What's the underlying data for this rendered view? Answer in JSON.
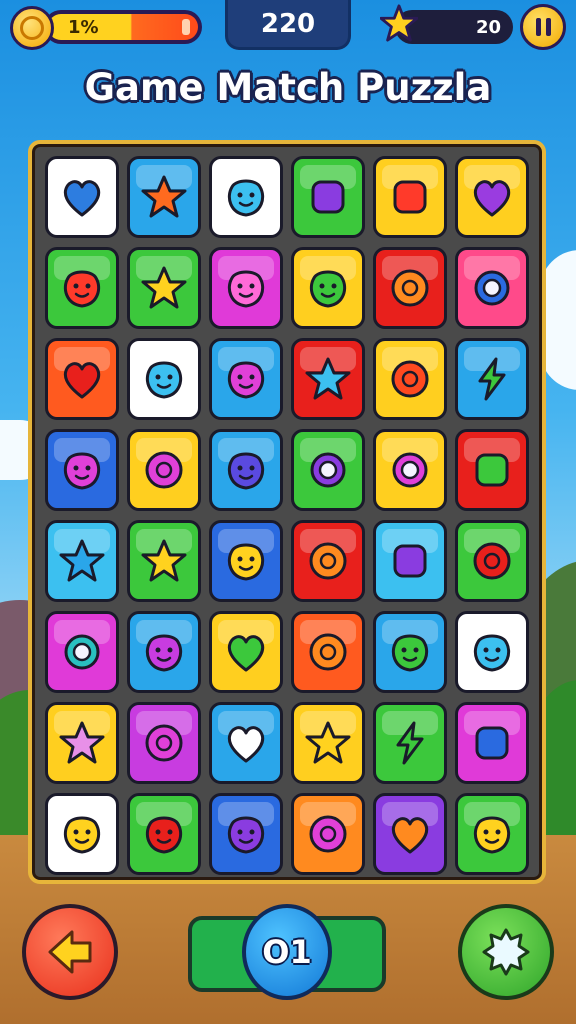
{
  "hud": {
    "coins_text": "1%",
    "score": "220",
    "stars": "20"
  },
  "title": "Game Match Puzzla",
  "board": {
    "rows": [
      [
        {
          "c": "#ffffff",
          "i": "heart",
          "g": "#2d7de0"
        },
        {
          "c": "#2aa6ea",
          "i": "star",
          "g": "#ff6a1f"
        },
        {
          "c": "#ffffff",
          "i": "face",
          "g": "#3cc0f0"
        },
        {
          "c": "#3cc83c",
          "i": "square",
          "g": "#8a3ce0"
        },
        {
          "c": "#ffcf1f",
          "i": "square",
          "g": "#ff3a2a"
        },
        {
          "c": "#ffcf1f",
          "i": "heart",
          "g": "#9a3ce0"
        }
      ],
      [
        {
          "c": "#3cc83c",
          "i": "face",
          "g": "#ff3a2a"
        },
        {
          "c": "#3cc83c",
          "i": "star",
          "g": "#ffd21f"
        },
        {
          "c": "#e03ad8",
          "i": "face",
          "g": "#ff6ad8"
        },
        {
          "c": "#ffcf1f",
          "i": "face",
          "g": "#3cc83c"
        },
        {
          "c": "#e8201c",
          "i": "circle",
          "g": "#ff8a1f"
        },
        {
          "c": "#ff4a8a",
          "i": "ring",
          "g": "#2a6ae0"
        }
      ],
      [
        {
          "c": "#ff5a1f",
          "i": "heart",
          "g": "#e8201c"
        },
        {
          "c": "#ffffff",
          "i": "face",
          "g": "#3cc0f0"
        },
        {
          "c": "#2aa6ea",
          "i": "face",
          "g": "#e040d8"
        },
        {
          "c": "#e8201c",
          "i": "star",
          "g": "#3cc0f0"
        },
        {
          "c": "#ffcf1f",
          "i": "circle",
          "g": "#ff4a1f"
        },
        {
          "c": "#2aa6ea",
          "i": "bolt",
          "g": "#3cc83c"
        }
      ],
      [
        {
          "c": "#2a6ae0",
          "i": "face",
          "g": "#e040d8"
        },
        {
          "c": "#ffcf1f",
          "i": "circle",
          "g": "#e040d8"
        },
        {
          "c": "#2aa6ea",
          "i": "face",
          "g": "#5a4ae0"
        },
        {
          "c": "#3cc83c",
          "i": "ring",
          "g": "#8a3ce0"
        },
        {
          "c": "#ffcf1f",
          "i": "ring",
          "g": "#e040d8"
        },
        {
          "c": "#e8201c",
          "i": "square",
          "g": "#3cc83c"
        }
      ],
      [
        {
          "c": "#3cc0f0",
          "i": "star",
          "g": "#2aa6ea"
        },
        {
          "c": "#3cc83c",
          "i": "star",
          "g": "#ffd21f"
        },
        {
          "c": "#2a6ae0",
          "i": "face",
          "g": "#ffd21f"
        },
        {
          "c": "#e8201c",
          "i": "circle",
          "g": "#ff8a1f"
        },
        {
          "c": "#3cc0f0",
          "i": "square",
          "g": "#8a3ce0"
        },
        {
          "c": "#3cc83c",
          "i": "circle",
          "g": "#e8201c"
        }
      ],
      [
        {
          "c": "#e03ad8",
          "i": "ring",
          "g": "#2ac0c0"
        },
        {
          "c": "#2aa6ea",
          "i": "face",
          "g": "#c83ce0"
        },
        {
          "c": "#ffcf1f",
          "i": "heart",
          "g": "#3cc83c"
        },
        {
          "c": "#ff5a1f",
          "i": "circle",
          "g": "#ff8a1f"
        },
        {
          "c": "#2aa6ea",
          "i": "face",
          "g": "#3cc83c"
        },
        {
          "c": "#ffffff",
          "i": "face",
          "g": "#3cc0f0"
        }
      ],
      [
        {
          "c": "#ffcf1f",
          "i": "star",
          "g": "#e890e8"
        },
        {
          "c": "#c83ce0",
          "i": "circle",
          "g": "#e040d8"
        },
        {
          "c": "#2aa6ea",
          "i": "heart",
          "g": "#ffffff"
        },
        {
          "c": "#ffcf1f",
          "i": "star",
          "g": "#ffd21f"
        },
        {
          "c": "#3cc83c",
          "i": "bolt",
          "g": "#3cc83c"
        },
        {
          "c": "#e03ad8",
          "i": "square",
          "g": "#2a6ae0"
        }
      ],
      [
        {
          "c": "#ffffff",
          "i": "face",
          "g": "#ffd21f"
        },
        {
          "c": "#3cc83c",
          "i": "face",
          "g": "#e8201c"
        },
        {
          "c": "#2a6ae0",
          "i": "face",
          "g": "#8a3ce0"
        },
        {
          "c": "#ff8a1f",
          "i": "circle",
          "g": "#e040d8"
        },
        {
          "c": "#8a3ce0",
          "i": "heart",
          "g": "#ff8a1f"
        },
        {
          "c": "#3cc83c",
          "i": "face",
          "g": "#ffd21f"
        }
      ]
    ]
  },
  "bottom": {
    "counter_text": "O1"
  }
}
